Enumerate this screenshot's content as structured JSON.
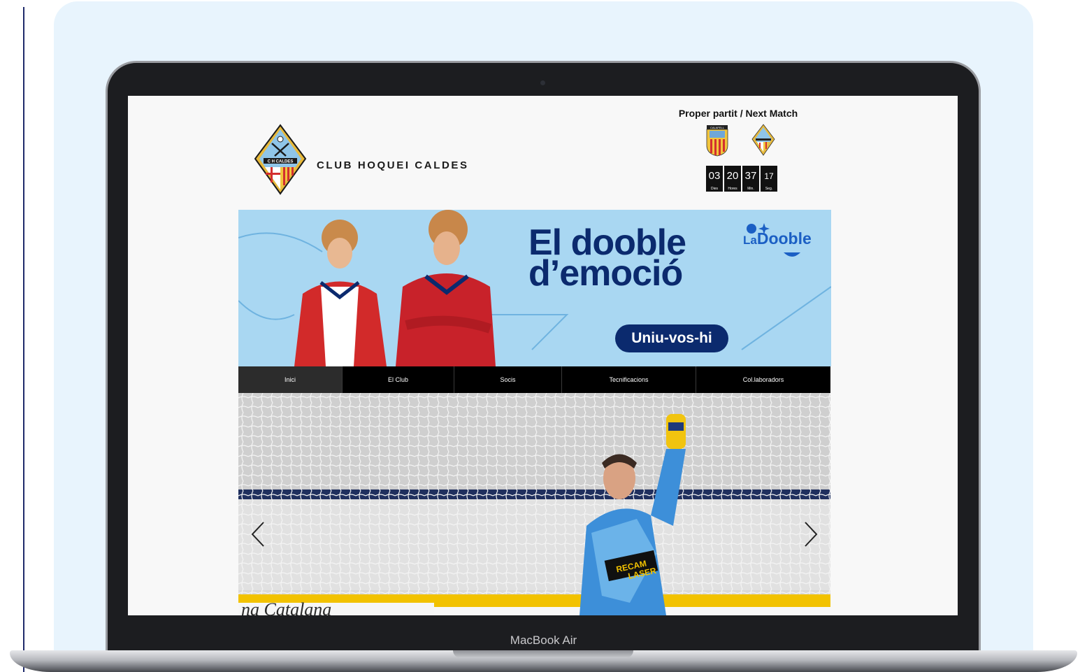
{
  "device_label": "MacBook Air",
  "site": {
    "club_name": "CLUB HOQUEI CALDES",
    "logo_text": "C H CALDES",
    "next_match": {
      "title": "Proper partit / Next Match",
      "home_crest_text": "CALAFELL",
      "countdown": [
        {
          "value": "03",
          "label": "Dies"
        },
        {
          "value": "20",
          "label": "Hores"
        },
        {
          "value": "37",
          "label": "Min."
        },
        {
          "value": "17",
          "label": "Seg."
        }
      ]
    }
  },
  "banner": {
    "headline_line1": "El dooble",
    "headline_line2": "d’emoció",
    "cta": "Uniu-vos-hi",
    "brand_prefix": "La",
    "brand_name": "Dooble"
  },
  "nav": {
    "items": [
      {
        "label": "Inici",
        "active": true
      },
      {
        "label": "El Club"
      },
      {
        "label": "Socis"
      },
      {
        "label": "Tecnificacions"
      },
      {
        "label": "Col.laboradors"
      }
    ]
  },
  "hero": {
    "jersey_sponsor_1": "RECAM",
    "jersey_sponsor_2": "LASER",
    "rink_board_text": "na Catalana"
  },
  "colors": {
    "panel_bg": "#e8f4fd",
    "banner_bg": "#a9d7f2",
    "brand_navy": "#0b2a6e",
    "nav_bg": "#000000"
  }
}
